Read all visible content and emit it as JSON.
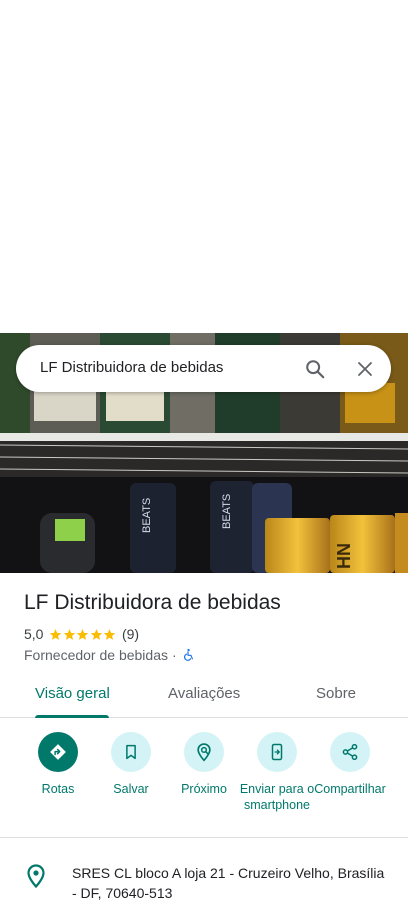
{
  "search": {
    "query": "LF Distribuidora de bebidas"
  },
  "photo": {
    "can_labels": [
      "BEATS",
      "BEATS",
      "HN"
    ]
  },
  "place": {
    "title": "LF Distribuidora de bebidas",
    "rating": "5,0",
    "rating_value": 5,
    "review_count": "(9)",
    "category": "Fornecedor de bebidas",
    "separator": "·",
    "address": "SRES CL bloco A loja 21 - Cruzeiro Velho, Brasília - DF, 70640-513"
  },
  "tabs": [
    {
      "label": "Visão geral",
      "active": true
    },
    {
      "label": "Avaliações",
      "active": false
    },
    {
      "label": "Sobre",
      "active": false
    }
  ],
  "actions": [
    {
      "label": "Rotas",
      "icon": "directions-icon"
    },
    {
      "label": "Salvar",
      "icon": "bookmark-icon"
    },
    {
      "label": "Próximo",
      "icon": "nearby-icon"
    },
    {
      "label": "Enviar para o smartphone",
      "icon": "send-to-phone-icon"
    },
    {
      "label": "Compartilhar",
      "icon": "share-icon"
    }
  ],
  "colors": {
    "accent": "#00796b",
    "action_bg": "#d4f3f6",
    "star": "#fbbc04"
  }
}
